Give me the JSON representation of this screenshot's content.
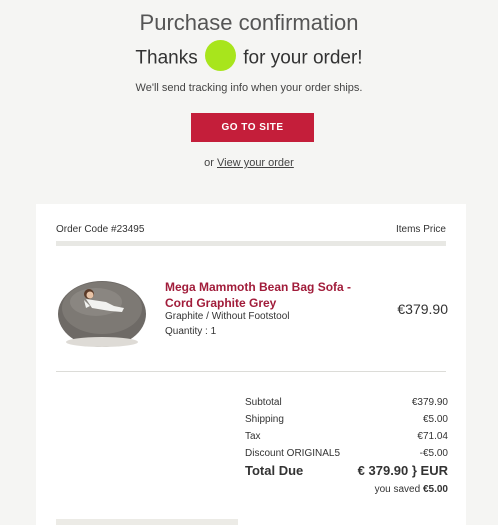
{
  "header": {
    "title": "Purchase confirmation",
    "thanks_before": "Thanks",
    "thanks_after": "for your order!",
    "dot_color": "#a8e51c",
    "tracking_text": "We'll send tracking info when your order ships.",
    "button_label": "GO TO SITE",
    "view_prefix": "or",
    "view_link": "View your order"
  },
  "order": {
    "code": "Order Code #23495",
    "columns": "Items Price"
  },
  "product": {
    "name": "Mega Mammoth Bean Bag Sofa - Cord Graphite Grey",
    "variant": "Graphite / Without Footstool",
    "quantity": "Quantity : 1",
    "price": "€379.90",
    "image_icon": "bean-bag-image"
  },
  "totals": [
    {
      "label": "Subtotal",
      "value": "€379.90"
    },
    {
      "label": "Shipping",
      "value": "€5.00"
    },
    {
      "label": "Tax",
      "value": "€71.04"
    },
    {
      "label": "Discount ORIGINAL5",
      "value": "-€5.00"
    }
  ],
  "total_due": {
    "label": "Total Due",
    "value": "€ 379.90 } EUR"
  },
  "saved": {
    "prefix": "you saved",
    "amount": "€5.00"
  },
  "colors": {
    "accent": "#c41e3a",
    "product_name": "#a11c3a",
    "background": "#f5f5f3"
  }
}
